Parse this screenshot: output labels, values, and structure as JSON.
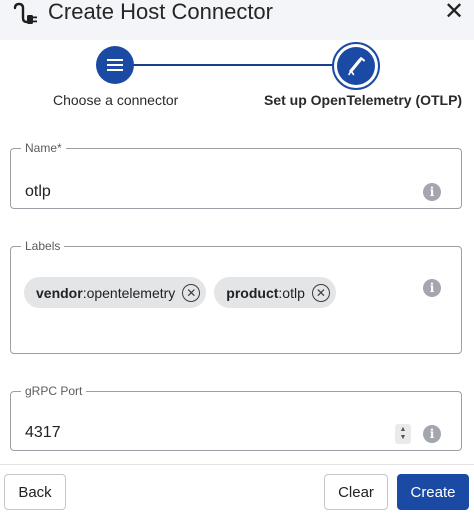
{
  "header": {
    "title": "Create Host Connector",
    "icon": "plug-icon",
    "close_label": "✕"
  },
  "stepper": {
    "steps": [
      {
        "label": "Choose a connector",
        "icon": "menu-icon",
        "state": "complete"
      },
      {
        "label": "Set up OpenTelemetry (OTLP)",
        "icon": "telescope-icon",
        "state": "active"
      }
    ],
    "accent": "#1b4aa5"
  },
  "form": {
    "name": {
      "label": "Name*",
      "value": "otlp"
    },
    "labels": {
      "label": "Labels",
      "chips": [
        {
          "key": "vendor",
          "value": "opentelemetry"
        },
        {
          "key": "product",
          "value": "otlp"
        }
      ]
    },
    "port": {
      "label": "gRPC Port",
      "value": "4317"
    }
  },
  "footer": {
    "back_label": "Back",
    "clear_label": "Clear",
    "create_label": "Create"
  }
}
